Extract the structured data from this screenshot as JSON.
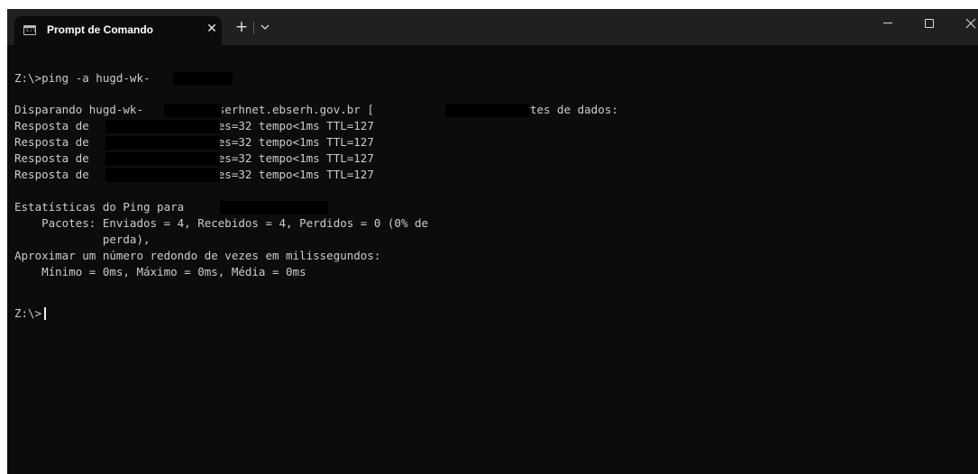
{
  "window": {
    "tab_title": "Prompt de Comando",
    "tab_close_glyph": "✕",
    "new_tab_glyph": "+",
    "icons": {
      "tab_icon": "cmd-icon",
      "dropdown": "chevron-down-icon",
      "minimize": "minimize-icon",
      "maximize": "maximize-icon",
      "close": "close-icon"
    },
    "colors": {
      "titlebar": "#202020",
      "terminal_bg": "#0c0c0c",
      "text": "#cccccc"
    }
  },
  "terminal": {
    "lines": [
      "Z:\\>ping -a hugd-wk-",
      "",
      "Disparando hugd-wk-        .ebserhnet.ebserh.gov.br [            ] com 32 bytes de dados:",
      "Resposta de                bytes=32 tempo<1ms TTL=127",
      "Resposta de                bytes=32 tempo<1ms TTL=127",
      "Resposta de                bytes=32 tempo<1ms TTL=127",
      "Resposta de                bytes=32 tempo<1ms TTL=127",
      "",
      "Estatísticas do Ping para              :",
      "    Pacotes: Enviados = 4, Recebidos = 4, Perdidos = 0 (0% de",
      "             perda),",
      "Aproximar um número redondo de vezes em milissegundos:",
      "    Mínimo = 0ms, Máximo = 0ms, Média = 0ms",
      "",
      "Z:\\>"
    ]
  }
}
